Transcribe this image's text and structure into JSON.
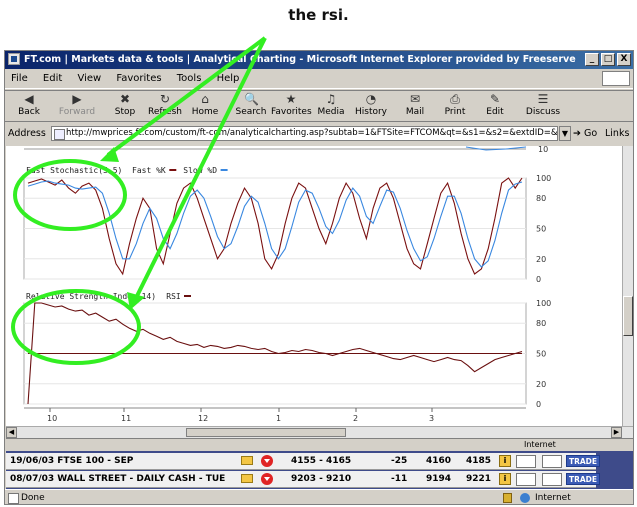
{
  "caption": "the rsi.",
  "window": {
    "title": "FT.com | Markets data & tools | Analytical Charting - Microsoft Internet Explorer provided by Freeserve",
    "controls": [
      "_",
      "□",
      "X"
    ]
  },
  "menu": [
    "File",
    "Edit",
    "View",
    "Favorites",
    "Tools",
    "Help"
  ],
  "toolbar": [
    {
      "label": "Back",
      "icon": "back-arrow-icon",
      "glyph": "◀"
    },
    {
      "label": "Forward",
      "icon": "forward-arrow-icon",
      "glyph": "▶"
    },
    {
      "label": "Stop",
      "icon": "stop-icon",
      "glyph": "✖"
    },
    {
      "label": "Refresh",
      "icon": "refresh-icon",
      "glyph": "↻"
    },
    {
      "label": "Home",
      "icon": "home-icon",
      "glyph": "⌂"
    },
    {
      "label": "Search",
      "icon": "search-icon",
      "glyph": "🔍"
    },
    {
      "label": "Favorites",
      "icon": "favorites-icon",
      "glyph": "★"
    },
    {
      "label": "Media",
      "icon": "media-icon",
      "glyph": "♫"
    },
    {
      "label": "History",
      "icon": "history-icon",
      "glyph": "◔"
    },
    {
      "label": "Mail",
      "icon": "mail-icon",
      "glyph": "✉"
    },
    {
      "label": "Print",
      "icon": "print-icon",
      "glyph": "⎙"
    },
    {
      "label": "Edit",
      "icon": "edit-icon",
      "glyph": "✎"
    },
    {
      "label": "Discuss",
      "icon": "discuss-icon",
      "glyph": "☰"
    }
  ],
  "address": {
    "label": "Address",
    "url": "http://mwprices.ft.com/custom/ft-com/analyticalcharting.asp?subtab=1&FTSite=FTCOM&qt=&s1=&s2=&extdID=&ticker=&com",
    "go": "Go",
    "links": "Links"
  },
  "chart_data": [
    {
      "type": "line",
      "title": "Fast Stochastic(5,5)",
      "series": [
        {
          "name": "Fast %K",
          "color": "#7a1010",
          "values": [
            95,
            97,
            99,
            96,
            93,
            98,
            90,
            85,
            92,
            95,
            88,
            70,
            40,
            15,
            5,
            35,
            60,
            80,
            70,
            30,
            15,
            45,
            75,
            90,
            95,
            80,
            60,
            40,
            20,
            30,
            55,
            75,
            90,
            80,
            55,
            20,
            10,
            25,
            55,
            80,
            95,
            90,
            70,
            50,
            35,
            55,
            80,
            95,
            85,
            60,
            40,
            70,
            90,
            95,
            80,
            55,
            30,
            15,
            10,
            35,
            60,
            85,
            95,
            75,
            45,
            20,
            5,
            10,
            30,
            60,
            95,
            100,
            90,
            100
          ]
        },
        {
          "name": "Slow %D",
          "color": "#3a88e0",
          "values": [
            92,
            94,
            96,
            97,
            95,
            94,
            93,
            90,
            89,
            90,
            91,
            85,
            65,
            40,
            20,
            20,
            35,
            55,
            70,
            60,
            40,
            30,
            45,
            65,
            82,
            88,
            80,
            62,
            42,
            30,
            35,
            52,
            72,
            82,
            76,
            55,
            30,
            20,
            30,
            52,
            76,
            88,
            85,
            70,
            52,
            45,
            58,
            78,
            90,
            82,
            62,
            55,
            72,
            88,
            86,
            70,
            48,
            30,
            18,
            22,
            40,
            62,
            82,
            82,
            65,
            40,
            20,
            12,
            18,
            38,
            65,
            88,
            94,
            96
          ]
        }
      ],
      "ylim": [
        0,
        100
      ],
      "ticks": [
        100,
        80,
        50,
        20,
        0
      ]
    },
    {
      "type": "line",
      "title": "Relative Strength Index(14)",
      "series": [
        {
          "name": "RSI",
          "color": "#6a1010",
          "values": [
            0,
            100,
            100,
            98,
            96,
            97,
            94,
            92,
            93,
            88,
            90,
            86,
            82,
            84,
            79,
            75,
            72,
            74,
            70,
            67,
            64,
            66,
            62,
            60,
            58,
            59,
            56,
            58,
            57,
            55,
            56,
            58,
            57,
            55,
            54,
            55,
            52,
            50,
            51,
            53,
            52,
            54,
            53,
            51,
            50,
            48,
            50,
            52,
            54,
            55,
            53,
            51,
            49,
            47,
            45,
            44,
            46,
            48,
            46,
            44,
            42,
            44,
            46,
            44,
            43,
            38,
            32,
            36,
            40,
            44,
            46,
            48,
            50,
            52
          ]
        },
        {
          "name": "",
          "color": "#6a1010",
          "values": [
            50,
            50,
            50,
            50,
            50,
            50,
            50,
            50,
            50,
            50,
            50,
            50,
            50,
            50,
            50,
            50,
            50,
            50,
            50,
            50,
            50,
            50,
            50,
            50,
            50,
            50,
            50,
            50,
            50,
            50,
            50,
            50,
            50,
            50,
            50,
            50,
            50,
            50,
            50,
            50,
            50,
            50,
            50,
            50,
            50,
            50,
            50,
            50,
            50,
            50,
            50,
            50,
            50,
            50,
            50,
            50,
            50,
            50,
            50,
            50,
            50,
            50,
            50,
            50,
            50,
            50,
            50,
            50,
            50,
            50,
            50,
            50,
            50,
            50
          ]
        }
      ],
      "ylim": [
        0,
        100
      ],
      "ticks": [
        100,
        80,
        50,
        20,
        0
      ]
    }
  ],
  "x_ticks": [
    "10",
    "11",
    "12",
    "1",
    "2",
    "3"
  ],
  "overlay_color": "#33ee22",
  "rows": [
    {
      "name": "19/06/03 FTSE 100 - SEP",
      "range": "4155 - 4165",
      "chg": "-25",
      "v1": "4160",
      "v2": "4185",
      "trade": "TRADE"
    },
    {
      "name": "08/07/03 WALL STREET - DAILY CASH - TUE",
      "range": "9203 - 9210",
      "chg": "-11",
      "v1": "9194",
      "v2": "9221",
      "trade": "TRADE"
    }
  ],
  "status": {
    "text": "Done",
    "zone": "Internet"
  },
  "inner_status": {
    "zone": "Internet"
  }
}
